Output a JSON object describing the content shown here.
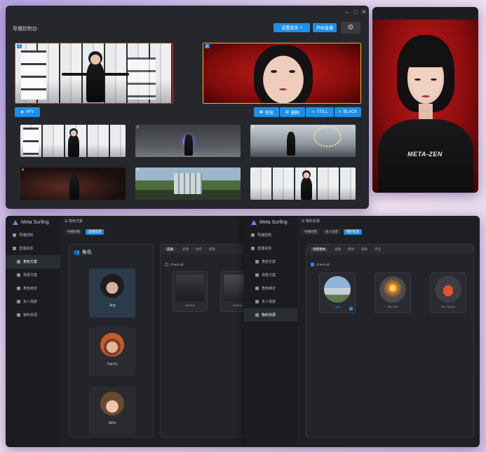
{
  "director": {
    "window_controls": [
      "–",
      "□",
      "✕"
    ],
    "title": "导播控制台:",
    "settings_menu_label": "设置菜单",
    "start_stream_label": "开始直播",
    "afv_label": "AFV",
    "switch_label": "特效",
    "delete_label": "删除",
    "still_label": "STILL",
    "black_label": "BLACK",
    "preview_tag": "1",
    "program_tag": "2",
    "scenes": [
      {
        "tag": "1"
      },
      {
        "tag": "2"
      },
      {
        "tag": "3"
      },
      {
        "tag": "4"
      },
      {
        "tag": "5"
      },
      {
        "tag": "6"
      }
    ]
  },
  "portrait": {
    "shirt_text": "META-ZEN"
  },
  "manager_left": {
    "logo": "Meta Surfing",
    "breadcrumb": "角色方案",
    "chips": [
      "导播控制",
      "直播资源"
    ],
    "sidebar": [
      {
        "label": "导播控制"
      },
      {
        "label": "直播资源"
      },
      {
        "label": "角色方案"
      },
      {
        "label": "场景方案"
      },
      {
        "label": "角色绑定"
      },
      {
        "label": "多人场景"
      },
      {
        "label": "物料资源"
      }
    ],
    "panel_title": "角色",
    "characters": [
      {
        "name": "Jing"
      },
      {
        "name": "TianYu"
      },
      {
        "name": "KiKo"
      }
    ],
    "tabs": [
      "皮肤",
      "表情",
      "动作",
      "配饰"
    ],
    "check_all": "Check all",
    "thumbs": [
      {
        "label": "skin0ne"
      },
      {
        "label": "skinTwo"
      }
    ]
  },
  "manager_right": {
    "logo": "Meta Surfing",
    "breadcrumb": "物料资源",
    "chips": [
      "导播控制",
      "多人场景",
      "物料资源"
    ],
    "sidebar": [
      {
        "label": "导播控制"
      },
      {
        "label": "直播资源"
      },
      {
        "label": "角色方案"
      },
      {
        "label": "场景方案"
      },
      {
        "label": "角色绑定"
      },
      {
        "label": "多人场景"
      },
      {
        "label": "物料资源"
      }
    ],
    "tabs": [
      "场景物体",
      "滤镜",
      "特效",
      "道具",
      "声音"
    ],
    "check_all": "Check all",
    "items": [
      {
        "label": "Light"
      },
      {
        "label": "NB_Fire"
      },
      {
        "label": "NB_Fanbar"
      }
    ]
  },
  "colors": {
    "accent": "#1f8fe6",
    "preview_border": "#d0352f",
    "program_border": "#e5c21a",
    "window_bg": "#26272c"
  }
}
